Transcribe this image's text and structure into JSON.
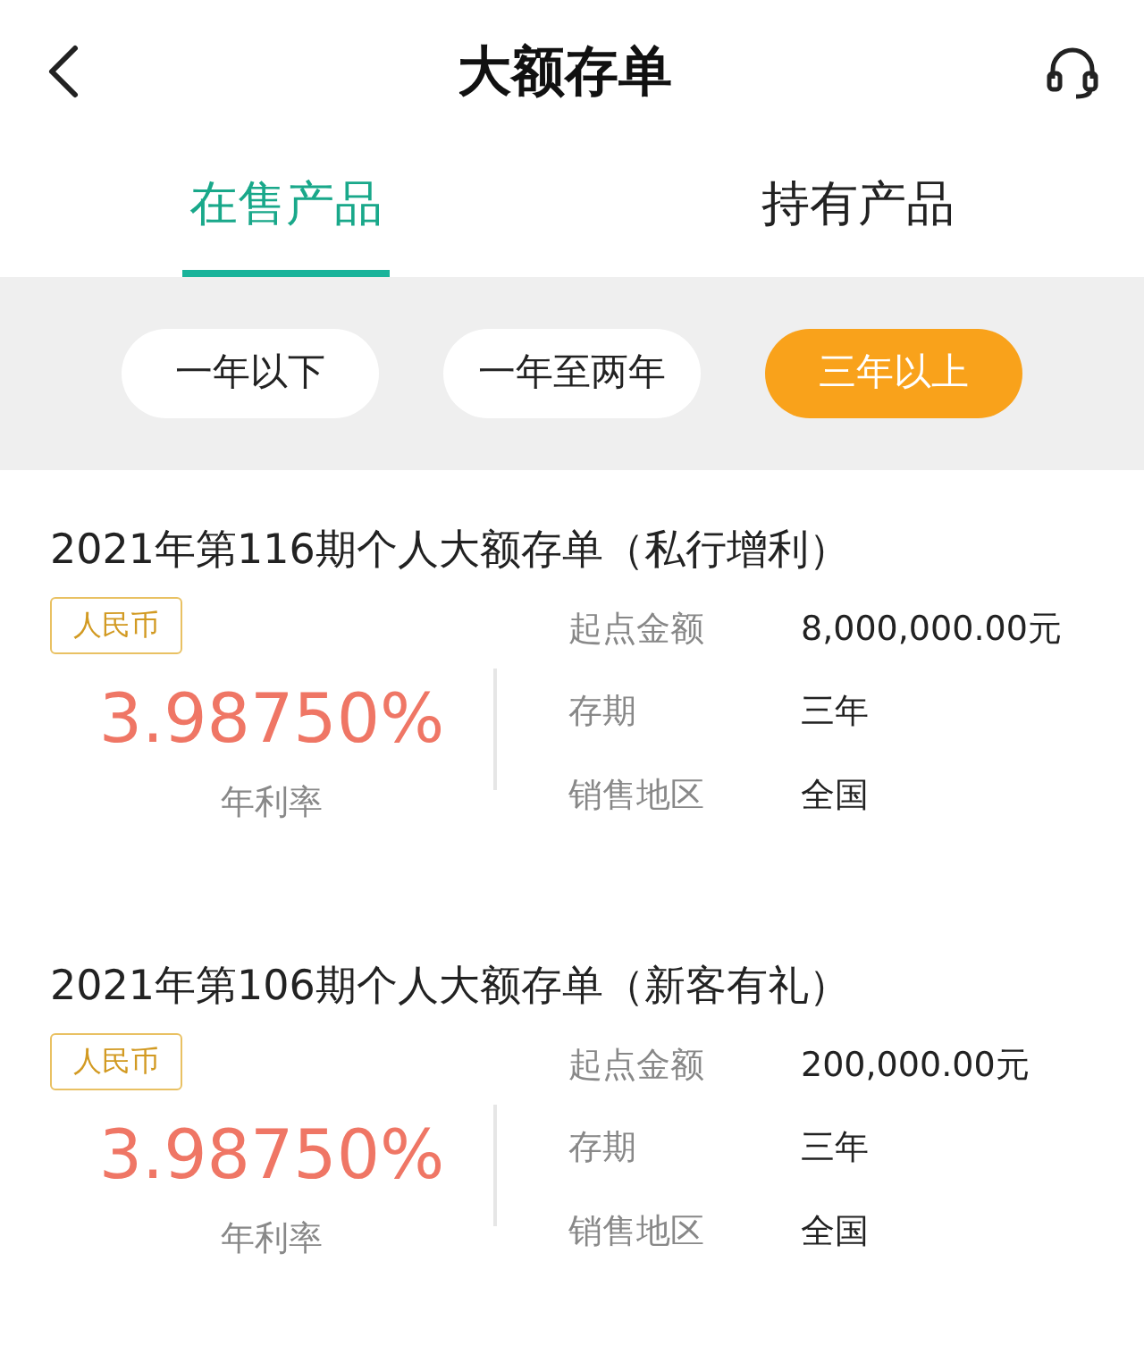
{
  "header": {
    "title": "大额存单"
  },
  "tabs": [
    {
      "label": "在售产品",
      "selected": true
    },
    {
      "label": "持有产品",
      "selected": false
    }
  ],
  "filters": [
    {
      "label": "一年以下",
      "selected": false
    },
    {
      "label": "一年至两年",
      "selected": false
    },
    {
      "label": "三年以上",
      "selected": true
    }
  ],
  "products": [
    {
      "name": "2021年第116期个人大额存单（私行增利）",
      "currency": "人民币",
      "rate": "3.98750%",
      "rate_label": "年利率",
      "details": [
        {
          "label": "起点金额",
          "value": "8,000,000.00元"
        },
        {
          "label": "存期",
          "value": "三年"
        },
        {
          "label": "销售地区",
          "value": "全国"
        }
      ]
    },
    {
      "name": "2021年第106期个人大额存单（新客有礼）",
      "currency": "人民币",
      "rate": "3.98750%",
      "rate_label": "年利率",
      "details": [
        {
          "label": "起点金额",
          "value": "200,000.00元"
        },
        {
          "label": "存期",
          "value": "三年"
        },
        {
          "label": "销售地区",
          "value": "全国"
        }
      ]
    }
  ]
}
